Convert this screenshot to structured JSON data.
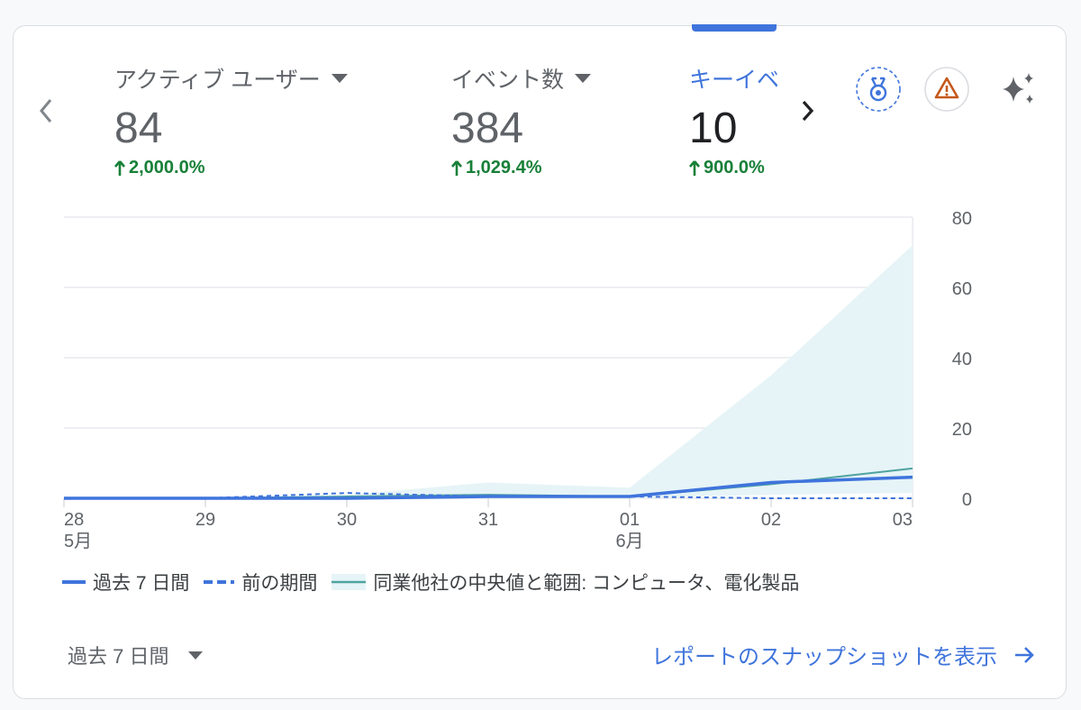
{
  "metrics": [
    {
      "label": "アクティブ ユーザー",
      "value": "84",
      "change": "2,000.0%",
      "trend": "up"
    },
    {
      "label": "イベント数",
      "value": "384",
      "change": "1,029.4%",
      "trend": "up"
    },
    {
      "label": "キーイベ",
      "value": "10",
      "change": "900.0%",
      "trend": "up",
      "selected": true
    }
  ],
  "icons": {
    "prev": "chevron-left-icon",
    "next": "chevron-right-icon",
    "badge": "medal-badge-icon",
    "warning": "warning-icon",
    "ai": "sparkle-icon"
  },
  "colors": {
    "primary": "#3f74dc",
    "positive": "#188038",
    "benchmark_fill": "#e6f4f7",
    "benchmark_line": "#4fa3a0",
    "warning": "#c5581b"
  },
  "chart_data": {
    "type": "line",
    "categories": [
      "28",
      "29",
      "30",
      "31",
      "01",
      "02",
      "03"
    ],
    "month_labels": [
      "5月",
      "",
      "",
      "",
      "6月",
      "",
      ""
    ],
    "ylim": [
      0,
      80
    ],
    "yticks": [
      0,
      20,
      40,
      60,
      80
    ],
    "series": [
      {
        "name": "過去 7 日間",
        "style": "solid",
        "values": [
          0,
          0,
          0,
          0.5,
          0.5,
          4.5,
          6
        ]
      },
      {
        "name": "前の期間",
        "style": "dashed",
        "values": [
          0,
          0,
          1.5,
          0.5,
          0.5,
          0,
          0
        ]
      },
      {
        "name": "同業他社の中央値と範囲: コンピュータ、電化製品",
        "style": "band",
        "median": [
          0,
          0,
          0.5,
          1,
          0.5,
          4,
          8.5
        ],
        "low": [
          0,
          0,
          0,
          0,
          0,
          1,
          1.5
        ],
        "high": [
          0,
          0,
          1,
          4.5,
          3,
          35,
          72
        ]
      }
    ],
    "legend_position": "bottom-left",
    "grid": true
  },
  "footer": {
    "range_label": "過去 7 日間",
    "link_label": "レポートのスナップショットを表示"
  }
}
